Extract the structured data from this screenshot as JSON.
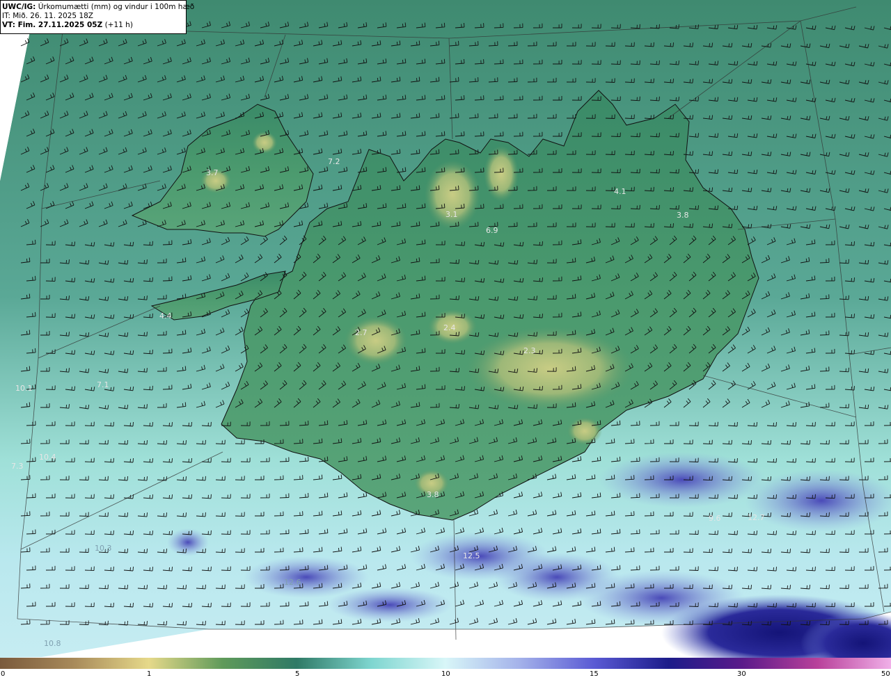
{
  "info": {
    "model": "UWC/IG:",
    "title_rest": " Úrkomumætti (mm) og vindur i 100m hæð",
    "init_time": "IT: Mið. 26. 11. 2025 18Z",
    "valid_label": "VT: Fim. 27.11.2025 05Z",
    "valid_offset": " (+11 h)"
  },
  "value_labels": [
    {
      "text": "3.7"
    },
    {
      "text": "7.2"
    },
    {
      "text": "3.1"
    },
    {
      "text": "6.9"
    },
    {
      "text": "4.1"
    },
    {
      "text": "3.8"
    },
    {
      "text": "4.4"
    },
    {
      "text": "2.7"
    },
    {
      "text": "2.4"
    },
    {
      "text": "2.3"
    },
    {
      "text": "7.1"
    },
    {
      "text": "10.1"
    },
    {
      "text": "10.4"
    },
    {
      "text": "7.3"
    },
    {
      "text": "3.8"
    },
    {
      "text": "10.3"
    },
    {
      "text": "12.6"
    },
    {
      "text": "12.5"
    },
    {
      "text": "9.6"
    },
    {
      "text": "12.7"
    },
    {
      "text": "10.8"
    }
  ],
  "colorbar": {
    "ticks": [
      "0",
      "1",
      "5",
      "10",
      "15",
      "30",
      "50"
    ],
    "colors": [
      "#7a5a3c",
      "#a88a5a",
      "#e6d98a",
      "#5f9a5a",
      "#2f7a66",
      "#7fd6d0",
      "#d8f6f8",
      "#a4b2ea",
      "#5a5ad4",
      "#1c1c8a",
      "#5a1a8a",
      "#b8409a",
      "#f0b0e8"
    ]
  },
  "colors": {
    "land_low": "#3f8a6a",
    "land_high": "#b8c27a",
    "sea": "#6fb8b0",
    "coastline": "#111111",
    "barb": "#111111"
  }
}
